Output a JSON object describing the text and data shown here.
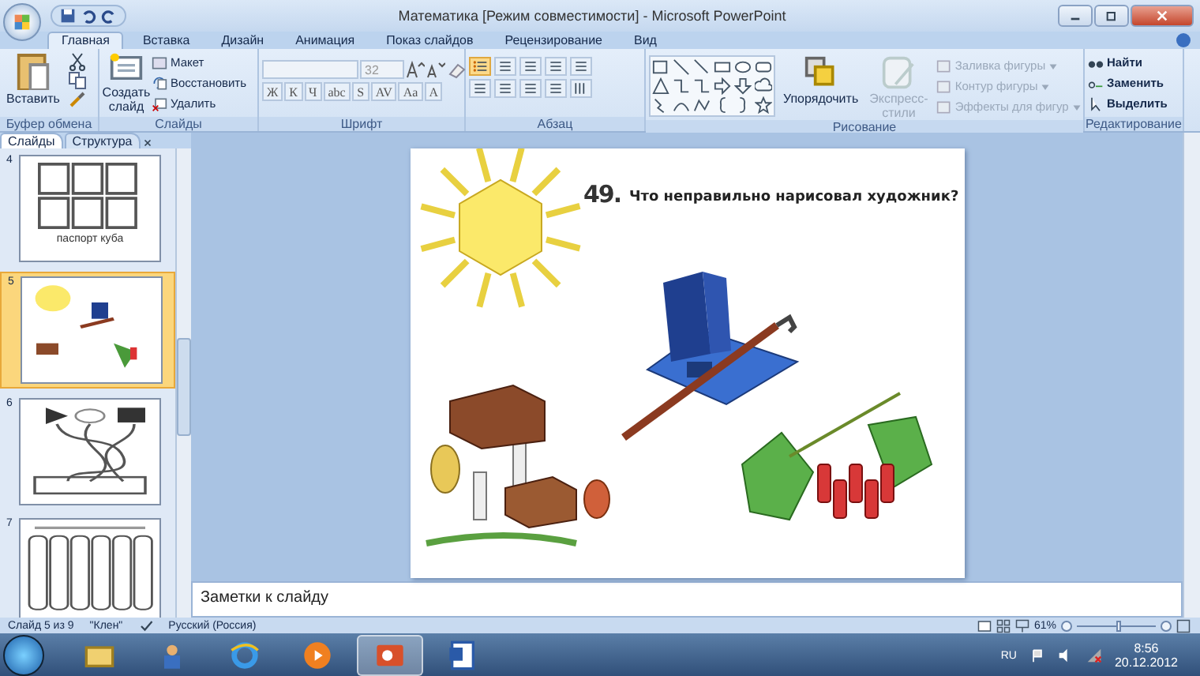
{
  "window": {
    "title": "Математика [Режим совместимости] - Microsoft PowerPoint"
  },
  "tabs": [
    {
      "label": "Главная",
      "selected": true
    },
    {
      "label": "Вставка",
      "selected": false
    },
    {
      "label": "Дизайн",
      "selected": false
    },
    {
      "label": "Анимация",
      "selected": false
    },
    {
      "label": "Показ слайдов",
      "selected": false
    },
    {
      "label": "Рецензирование",
      "selected": false
    },
    {
      "label": "Вид",
      "selected": false
    }
  ],
  "ribbon": {
    "clipboard": {
      "label": "Буфер обмена",
      "paste": "Вставить"
    },
    "slides": {
      "label": "Слайды",
      "new_slide": "Создать слайд",
      "items": [
        "Макет",
        "Восстановить",
        "Удалить"
      ]
    },
    "font": {
      "label": "Шрифт",
      "size": "32",
      "buttons": [
        "Ж",
        "К",
        "Ч",
        "abc",
        "S",
        "AV",
        "Aa",
        "A"
      ]
    },
    "paragraph": {
      "label": "Абзац"
    },
    "drawing": {
      "label": "Рисование",
      "arrange": "Упорядочить",
      "quick_styles": {
        "label": "Экспресс-стили",
        "disabled": true
      },
      "items": [
        {
          "label": "Заливка фигуры",
          "disabled": true
        },
        {
          "label": "Контур фигуры",
          "disabled": true
        },
        {
          "label": "Эффекты для фигур",
          "disabled": true
        }
      ]
    },
    "editing": {
      "label": "Редактирование",
      "items": [
        "Найти",
        "Заменить",
        "Выделить"
      ]
    }
  },
  "panel": {
    "tabs": [
      {
        "label": "Слайды",
        "selected": true
      },
      {
        "label": "Структура",
        "selected": false
      }
    ],
    "thumbnails": [
      {
        "number": "4",
        "kind": "grid",
        "caption": "паспорт куба",
        "selected": false
      },
      {
        "number": "5",
        "kind": "picture",
        "selected": true
      },
      {
        "number": "6",
        "kind": "maze",
        "selected": false
      },
      {
        "number": "7",
        "kind": "cards",
        "selected": false
      }
    ]
  },
  "slide": {
    "number_label": "49.",
    "question": "Что неправильно нарисовал художник?"
  },
  "notes": {
    "placeholder": "Заметки к слайду"
  },
  "status_bar": {
    "slide": "Слайд 5 из 9",
    "theme": "\"Клен\"",
    "language": "Русский (Россия)",
    "zoom": "61%",
    "zoom_slider": {
      "level": 0.55
    }
  },
  "taskbar": {
    "apps": [
      {
        "kind": "folder",
        "selected": false
      },
      {
        "kind": "person",
        "selected": false
      },
      {
        "kind": "browser",
        "selected": false
      },
      {
        "kind": "player",
        "selected": false
      },
      {
        "kind": "slides",
        "selected": true
      },
      {
        "kind": "document",
        "selected": false
      }
    ],
    "language": "RU",
    "time": "8:56",
    "date": "20.12.2012"
  }
}
